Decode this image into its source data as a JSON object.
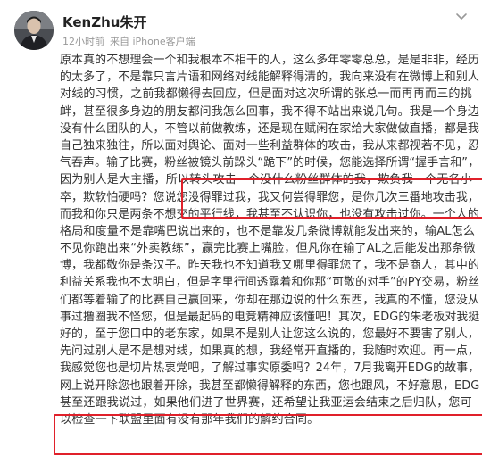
{
  "author": {
    "name": "KenZhu朱开",
    "time": "12小时前",
    "source": "来自 iPhone客户端"
  },
  "colors": {
    "highlight": "#e0202a",
    "text": "#333333",
    "meta": "#999999"
  },
  "icons": {
    "menu": "chevron-down-icon",
    "avatar": "avatar-photo"
  },
  "post_lines": [
    "原本真的不想理会一个和我根本不相干的人，这么多年零零总总，是是非非，经历",
    "的太多了，不是靠只言片语和网络对线能解释得清的，我向来没有在微博上和别人",
    "对线的习惯，之前我都懒得去回应，但是面对这次所谓的张总一而再再而三的挑",
    "衅，甚至很多身边的朋友都问我怎么回事，我不得不站出来说几句。我是一个身边",
    "没有什么团队的人，不管以前做教练，还是现在赋闲在家给大家做做直播，都是我",
    "自己独来独往，所以面对舆论、面对一些利益群体的攻击，我从来都视若不见，忍",
    "气吞声。输了比赛，粉丝被镜头前跺头“跪下”的时候，您能选择所谓“握手言和”，",
    "因为别人是大主播，所以转头攻击一个没什么粉丝群体的我，欺负我一个无名小",
    "卒，欺软怕硬吗？您说您没得罪过我，我又何尝得罪您，是你几次三番地攻击我，",
    "而我和你只是两条不想交的平行线，我甚至不认识你，也没有攻击过你。一个人的",
    "格局和度量不是靠嘴巴说出来的，也不是靠发几条微博就能发出来的，输AL怎么",
    "不见你跑出来“外卖教练”，赢完比赛上嘴脸，但凡你在输了AL之后能发出那条微",
    "博，我都敬你是条汉子。昨天我也不知道我又哪里得罪您了，我不是商人，其中的",
    "利益关系我也不太明白，但是字里行间透露着和你那“可敬的对手”的PY交易，粉丝",
    "们都等着输了的比赛自己赢回来，你却在那边说的什么东西，我真的不懂，您没从",
    "事过撸圈我不怪您，但是最起码的电竞精神应该懂吧！其次，EDG的朱老板对我挺",
    "好的，至于您口中的老东家，如果不是别人让您这么说的，您最好不要害了别人，",
    "先问过别人是不是想对线，如果真的想，我经常开直播的，我随时欢迎。再一点，",
    "我感觉您也是切片热衷党吧，了解过事实原委吗？24年，7月我离开EDG的故事，",
    "网上说开除您也跟着开除，我甚至都懒得解释的东西，您也跟风，不好意思，EDG",
    "甚至还跟我说过，如果他们进了世界赛，还希望让我亚运会结束之后归队，您可",
    "以检查一下联盟里面有没有那年我们的解约合同。"
  ]
}
